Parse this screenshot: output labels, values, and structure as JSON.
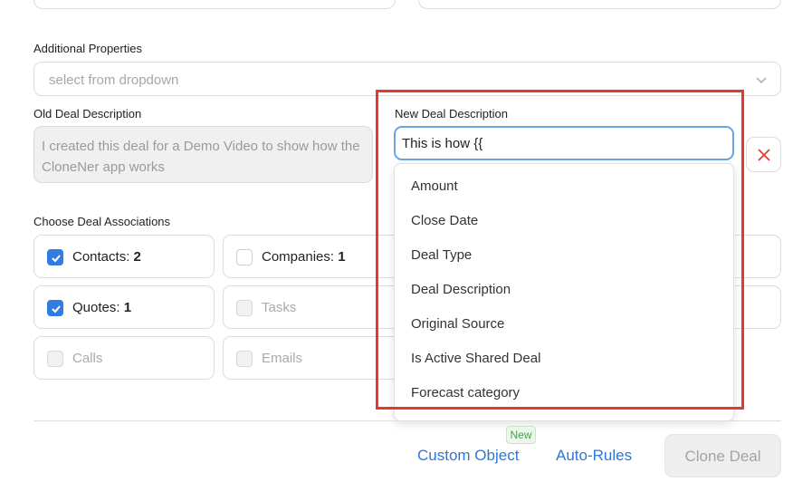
{
  "additional_properties": {
    "label": "Additional Properties",
    "placeholder": "select from dropdown",
    "chevron_icon": "chevron-down-icon"
  },
  "old_description": {
    "label": "Old Deal Description",
    "value": "I created this deal for a Demo Video to show how the CloneNer app works"
  },
  "new_description": {
    "label": "New Deal Description",
    "value": "This is how {{",
    "delete_icon": "close-icon",
    "delete_color": "#e53a2a",
    "options": [
      "Amount",
      "Close Date",
      "Deal Type",
      "Deal Description",
      "Original Source",
      "Is Active Shared Deal",
      "Forecast category"
    ]
  },
  "associations": {
    "label": "Choose Deal Associations",
    "items": [
      {
        "name": "Contacts:",
        "count": "2",
        "checked": true,
        "disabled": false
      },
      {
        "name": "Companies:",
        "count": "1",
        "checked": false,
        "disabled": false
      },
      {
        "name": "Quotes:",
        "count": "1",
        "checked": true,
        "disabled": false
      },
      {
        "name": "Tasks",
        "count": "",
        "checked": false,
        "disabled": true
      },
      {
        "name": "Calls",
        "count": "",
        "checked": false,
        "disabled": true
      },
      {
        "name": "Emails",
        "count": "",
        "checked": false,
        "disabled": true
      }
    ]
  },
  "footer": {
    "new_badge": "New",
    "custom_object": "Custom Object",
    "auto_rules": "Auto-Rules",
    "clone_deal": "Clone Deal"
  },
  "colors": {
    "accent": "#2f77d6",
    "checkbox": "#2f7de1",
    "highlight": "#e53a2a",
    "focus_border": "#6aa3e8"
  }
}
